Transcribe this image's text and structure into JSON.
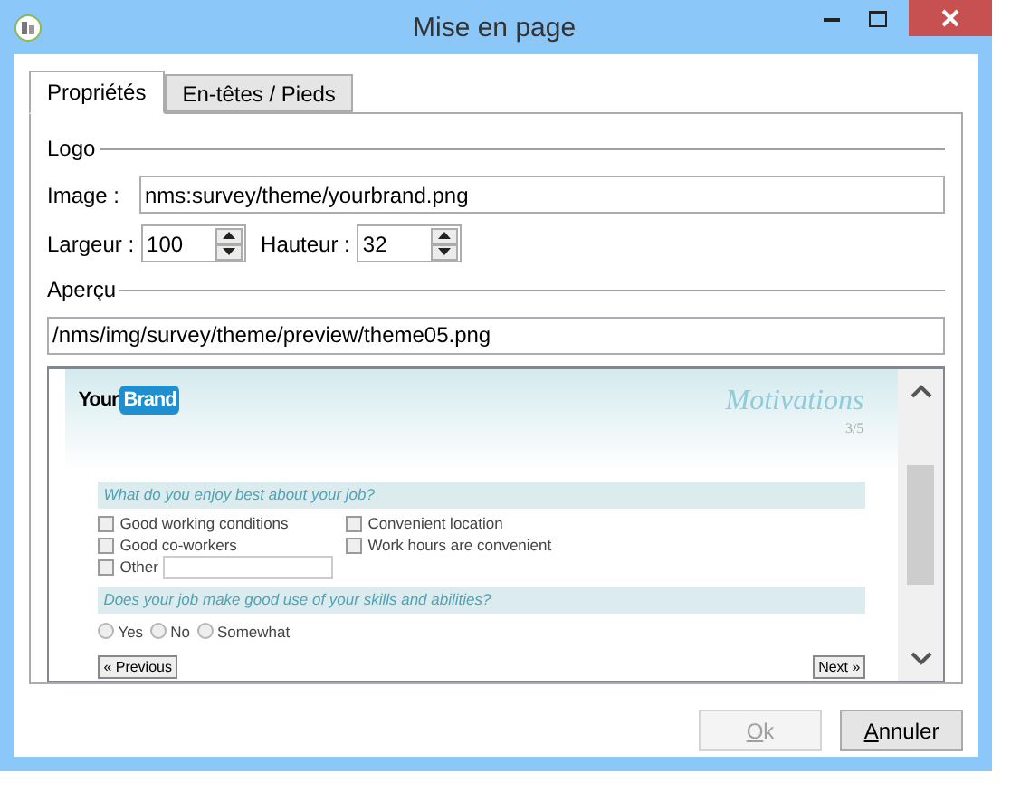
{
  "window": {
    "title": "Mise en page"
  },
  "tabs": [
    {
      "label": "Propriétés",
      "selected": true
    },
    {
      "label": "En-têtes / Pieds",
      "selected": false
    }
  ],
  "logo_section": {
    "heading": "Logo"
  },
  "image": {
    "label": "Image :",
    "value": "nms:survey/theme/yourbrand.png"
  },
  "width": {
    "label": "Largeur :",
    "value": "100"
  },
  "height": {
    "label": "Hauteur :",
    "value": "32"
  },
  "preview_section": {
    "heading": "Aperçu"
  },
  "preview_path": {
    "value": "/nms/img/survey/theme/preview/theme05.png"
  },
  "preview": {
    "logo": {
      "part_1": "Your",
      "part_2": "Brand"
    },
    "page_title": "Motivations",
    "page_counter": "3/5",
    "questions": [
      {
        "text": "What do you enjoy best about your job?",
        "kind": "checkbox",
        "options": [
          {
            "label": "Good working conditions",
            "checked": false,
            "kind": "plain"
          },
          {
            "label": "Convenient location",
            "checked": false,
            "kind": "plain"
          },
          {
            "label": "Good co-workers",
            "checked": false,
            "kind": "plain"
          },
          {
            "label": "Work hours are convenient",
            "checked": false,
            "kind": "plain"
          },
          {
            "label": "Other",
            "checked": false,
            "kind": "other"
          }
        ]
      },
      {
        "text": "Does your job make good use of your skills and abilities?",
        "kind": "radio",
        "options": [
          {
            "label": "Yes",
            "checked": false
          },
          {
            "label": "No",
            "checked": false
          },
          {
            "label": "Somewhat",
            "checked": false
          }
        ]
      }
    ],
    "previous": "« Previous",
    "next": "Next »"
  },
  "buttons": [
    {
      "mnemonic": "O",
      "rest": "k",
      "disabled": true
    },
    {
      "mnemonic": "A",
      "rest": "nnuler",
      "disabled": false
    }
  ]
}
